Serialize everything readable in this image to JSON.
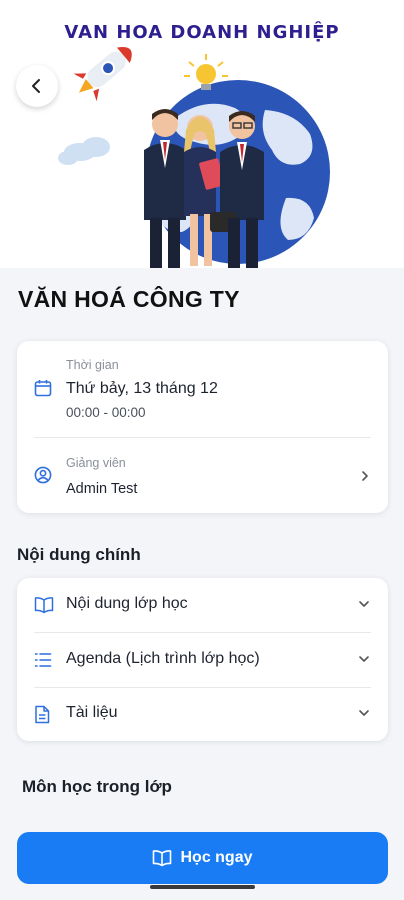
{
  "banner": {
    "title": "VAN HOA DOANH NGHIỆP"
  },
  "page": {
    "title": "VĂN HOÁ CÔNG TY"
  },
  "info": {
    "time_label": "Thời gian",
    "date": "Thứ bảy, 13 tháng 12",
    "time_range": "00:00 - 00:00",
    "instructor_label": "Giảng viên",
    "instructor_name": "Admin Test"
  },
  "main_content": {
    "title": "Nội dung chính",
    "items": [
      {
        "label": "Nội dung lớp học",
        "icon": "book-icon"
      },
      {
        "label": "Agenda (Lịch trình lớp học)",
        "icon": "list-icon"
      },
      {
        "label": "Tài liệu",
        "icon": "document-icon"
      }
    ]
  },
  "subjects": {
    "title": "Môn học trong lớp"
  },
  "cta": {
    "label": "Học ngay",
    "icon": "book-icon"
  },
  "colors": {
    "accent": "#1a7cf5",
    "banner_title": "#2d1f8f",
    "icon_blue": "#2f6fe0"
  }
}
